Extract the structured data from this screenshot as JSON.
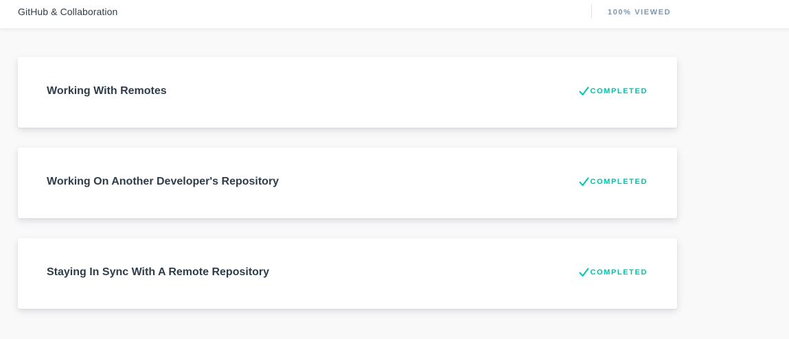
{
  "header": {
    "title": "GitHub & Collaboration",
    "progress": "100% VIEWED"
  },
  "lessons": [
    {
      "title": "Working With Remotes",
      "status": "COMPLETED",
      "status_icon": "check-icon"
    },
    {
      "title": "Working On Another Developer's Repository",
      "status": "COMPLETED",
      "status_icon": "check-icon"
    },
    {
      "title": "Staying In Sync With A Remote Repository",
      "status": "COMPLETED",
      "status_icon": "check-icon"
    }
  ],
  "colors": {
    "accent": "#02c2b0",
    "text": "#2e3d49",
    "muted": "#7d97ad",
    "background": "#f9f9fa"
  }
}
